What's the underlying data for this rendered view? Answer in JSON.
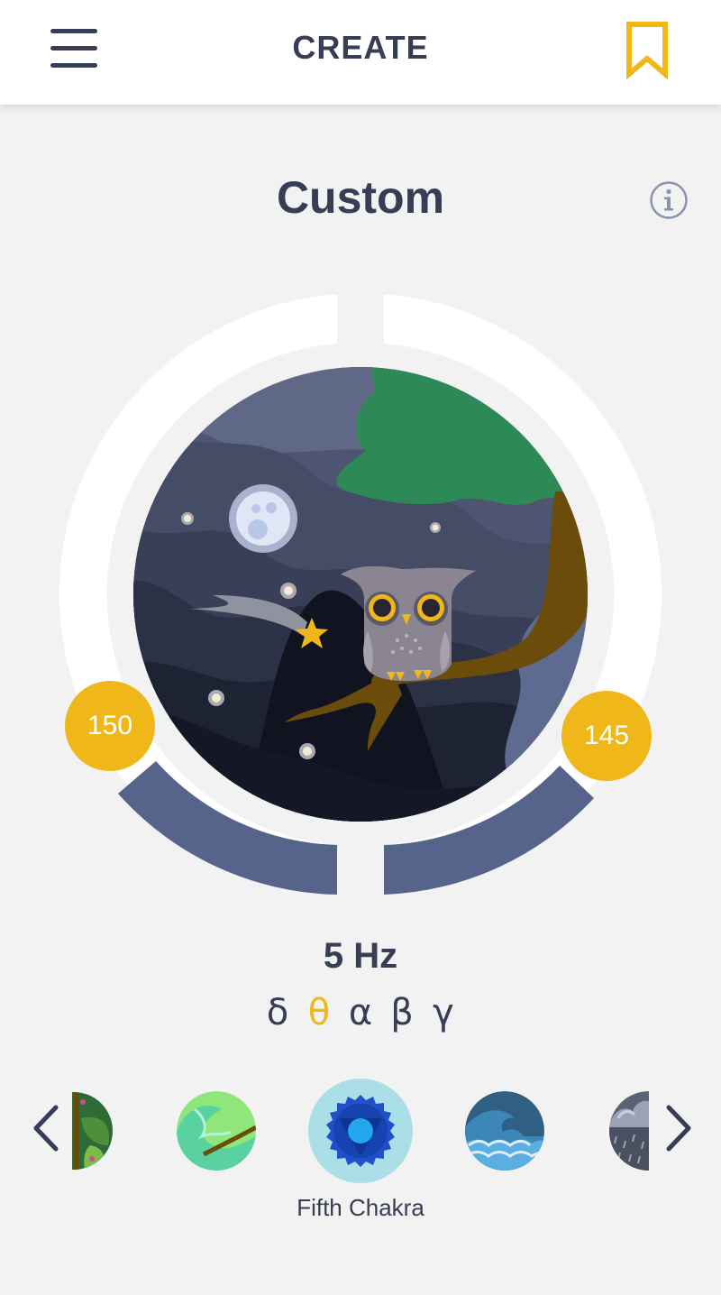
{
  "header": {
    "menu_icon": "hamburger-menu-icon",
    "title": "CREATE",
    "bookmark_icon": "bookmark-icon"
  },
  "page": {
    "title": "Custom",
    "info_icon": "info-icon"
  },
  "dial": {
    "left_value": "150",
    "right_value": "145",
    "scene_icon": "owl-night-scene-illustration"
  },
  "frequency": {
    "label": "5 Hz",
    "bands": [
      "δ",
      "θ",
      "α",
      "β",
      "γ"
    ],
    "active_band": "θ"
  },
  "carousel": {
    "prev_icon": "chevron-left-icon",
    "next_icon": "chevron-right-icon",
    "items": [
      {
        "icon": "jungle-leaves-icon"
      },
      {
        "icon": "green-stream-branch-icon"
      },
      {
        "icon": "fifth-chakra-icon"
      },
      {
        "icon": "ocean-waves-icon"
      },
      {
        "icon": "rain-cloud-icon"
      }
    ],
    "selected_label": "Fifth Chakra"
  },
  "colors": {
    "accent": "#f0b71b",
    "text_dark": "#363d55",
    "ring_blue": "#56648c",
    "background": "#f2f2f2"
  }
}
